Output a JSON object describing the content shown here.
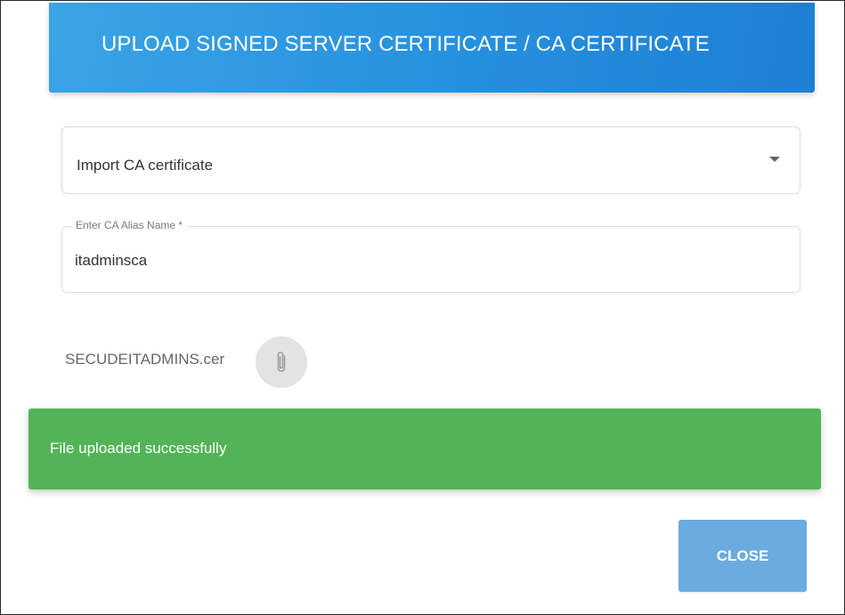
{
  "dialog": {
    "title": "UPLOAD SIGNED SERVER CERTIFICATE / CA CERTIFICATE",
    "header_color": "#2590de"
  },
  "certificate_type": {
    "selected": "Import CA certificate"
  },
  "alias_field": {
    "label": "Enter CA Alias Name *",
    "value": "itadminsca"
  },
  "file": {
    "name": "SECUDEITADMINS.cer",
    "attach_icon": "paperclip-icon"
  },
  "snackbar": {
    "message": "File uploaded successfully",
    "color": "#52b457"
  },
  "actions": {
    "close_label": "CLOSE",
    "close_color": "#6cabdf"
  }
}
